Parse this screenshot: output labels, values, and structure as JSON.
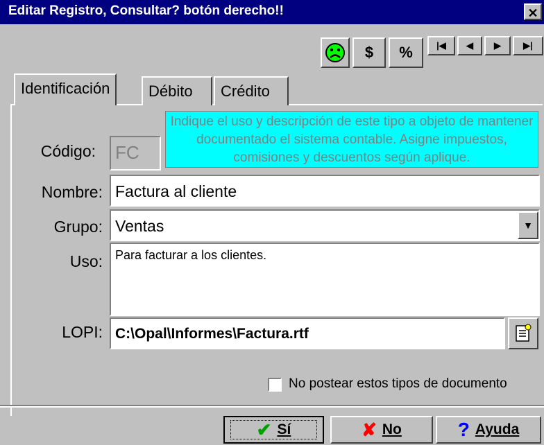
{
  "window": {
    "title": "Editar Registro, Consultar? botón derecho!!",
    "close_glyph": "✕"
  },
  "toolbar": {
    "face_icon": "sad-face-icon",
    "dollar_label": "$",
    "percent_label": "%",
    "nav": [
      "|◀",
      "◀",
      "▶",
      "▶|"
    ]
  },
  "tabs": [
    "Identificación",
    "Débito",
    "Crédito"
  ],
  "hint": "Indique el uso y descripción de este tipo a objeto de mantener documentado el sistema contable. Asigne impuestos, comisiones y descuentos según aplique.",
  "form": {
    "codigo_label": "Código:",
    "codigo_value": "FC",
    "nombre_label": "Nombre:",
    "nombre_value": "Factura al cliente",
    "grupo_label": "Grupo:",
    "grupo_value": "Ventas",
    "uso_label": "Uso:",
    "uso_value": "Para facturar a los clientes.",
    "lopi_label": "LOPI:",
    "lopi_value": "C:\\Opal\\Informes\\Factura.rtf",
    "checkbox_label": "No postear estos tipos de documento"
  },
  "buttons": {
    "si": "Sí",
    "no": "No",
    "ayuda": "Ayuda"
  },
  "colors": {
    "titlebar": "#000080",
    "hint_bg": "#00ffff",
    "face": "#00ff00",
    "check": "#00a000",
    "x": "#ff0000",
    "help": "#0000ff"
  }
}
